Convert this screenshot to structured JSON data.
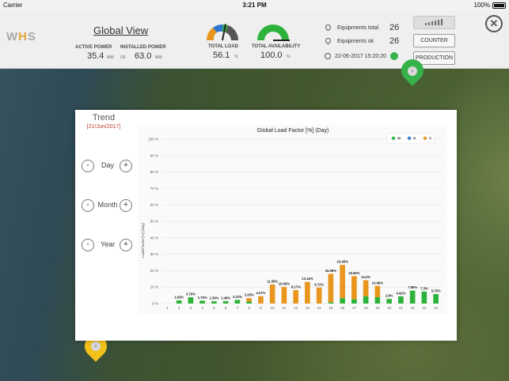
{
  "status_bar": {
    "carrier": "Carrier",
    "time": "3:21 PM",
    "battery": "100%"
  },
  "header": {
    "logo": {
      "a": "W",
      "b": "H",
      "c": "S"
    },
    "title": "Global View",
    "active_power": {
      "label": "ACTIVE POWER",
      "value": "35.4",
      "unit": "MW"
    },
    "installed_power": {
      "label": "INSTALLED POWER",
      "prefix": "OF",
      "value": "63.0",
      "unit": "MW"
    },
    "total_load": {
      "label": "TOTAL LOAD",
      "value": "56.1",
      "unit": "%",
      "fraction": 0.561
    },
    "total_availability": {
      "label": "TOTAL AVAILABILITY",
      "value": "100.0",
      "unit": "%",
      "fraction": 1.0
    },
    "equipments_total": {
      "label": "Equipments total",
      "value": "26"
    },
    "equipments_ok": {
      "label": "Equipments ok",
      "value": "26"
    },
    "timestamp": "22-06-2017 15:20:20",
    "counter_label": "COUNTER",
    "production_label": "PRODUCTION",
    "close_glyph": "✕"
  },
  "map": {
    "marker_glyph": "›"
  },
  "trend": {
    "title": "Trend",
    "date": "[21/Jun/2017]",
    "controls": [
      {
        "label": "Day",
        "minus": "-",
        "plus": "+"
      },
      {
        "label": "Month",
        "minus": "-",
        "plus": "+"
      },
      {
        "label": "Year",
        "minus": "-",
        "plus": "+"
      }
    ]
  },
  "chart_data": {
    "type": "bar",
    "title": "Global Load Factor [%] (Day)",
    "ylabel": "Load Factor [%] (Day)",
    "ylim": [
      0,
      100
    ],
    "yticks": [
      "0 %",
      "10 %",
      "20 %",
      "30 %",
      "40 %",
      "50 %",
      "60 %",
      "70 %",
      "80 %",
      "90 %",
      "100 %"
    ],
    "categories": [
      "1",
      "2",
      "3",
      "4",
      "5",
      "6",
      "7",
      "8",
      "9",
      "10",
      "11",
      "12",
      "13",
      "14",
      "15",
      "16",
      "17",
      "18",
      "19",
      "20",
      "21",
      "22",
      "23",
      "24"
    ],
    "legend": [
      {
        "name": "W",
        "color": "#2db33b"
      },
      {
        "name": "H",
        "color": "#2e78d0"
      },
      {
        "name": "S",
        "color": "#e8961e"
      }
    ],
    "legend_position": "top-right",
    "totals": [
      0,
      1.93,
      3.79,
      1.79,
      1.39,
      1.49,
      2.22,
      3.28,
      4.47,
      11.55,
      10.06,
      8.17,
      13.14,
      9.72,
      18.08,
      23.48,
      16.65,
      14.2,
      10.69,
      2.8,
      4.42,
      7.86,
      7.3,
      5.75
    ],
    "data_labels": [
      "",
      "1.93%",
      "3.79%",
      "1.79%",
      "1.39%",
      "1.49%",
      "2.22%",
      "3.28%",
      "4.47%",
      "11.55%",
      "10.06%",
      "8.17%",
      "13.14%",
      "9.72%",
      "18.08%",
      "23.48%",
      "16.65%",
      "14.2%",
      "10.69%",
      "2.8%",
      "4.42%",
      "7.86%",
      "7.3%",
      "5.75%"
    ],
    "series": [
      {
        "name": "W",
        "values": [
          0,
          1.93,
          3.79,
          1.79,
          1.39,
          1.49,
          2.22,
          1.2,
          0,
          0,
          0,
          0,
          0,
          0,
          0.8,
          3.3,
          2.6,
          4.4,
          3.9,
          2.8,
          4.42,
          7.86,
          7.3,
          5.75
        ]
      },
      {
        "name": "H",
        "values": [
          0,
          0,
          0,
          0,
          0,
          0,
          0,
          0,
          0,
          0,
          0,
          0,
          0,
          0,
          0,
          0,
          0,
          0,
          0,
          0,
          0,
          0,
          0,
          0
        ]
      },
      {
        "name": "S",
        "values": [
          0,
          0,
          0,
          0,
          0,
          0,
          0,
          2.08,
          4.47,
          11.55,
          10.06,
          8.17,
          13.14,
          9.72,
          17.28,
          20.18,
          14.05,
          9.8,
          6.79,
          0,
          0,
          0,
          0,
          0
        ]
      }
    ]
  }
}
